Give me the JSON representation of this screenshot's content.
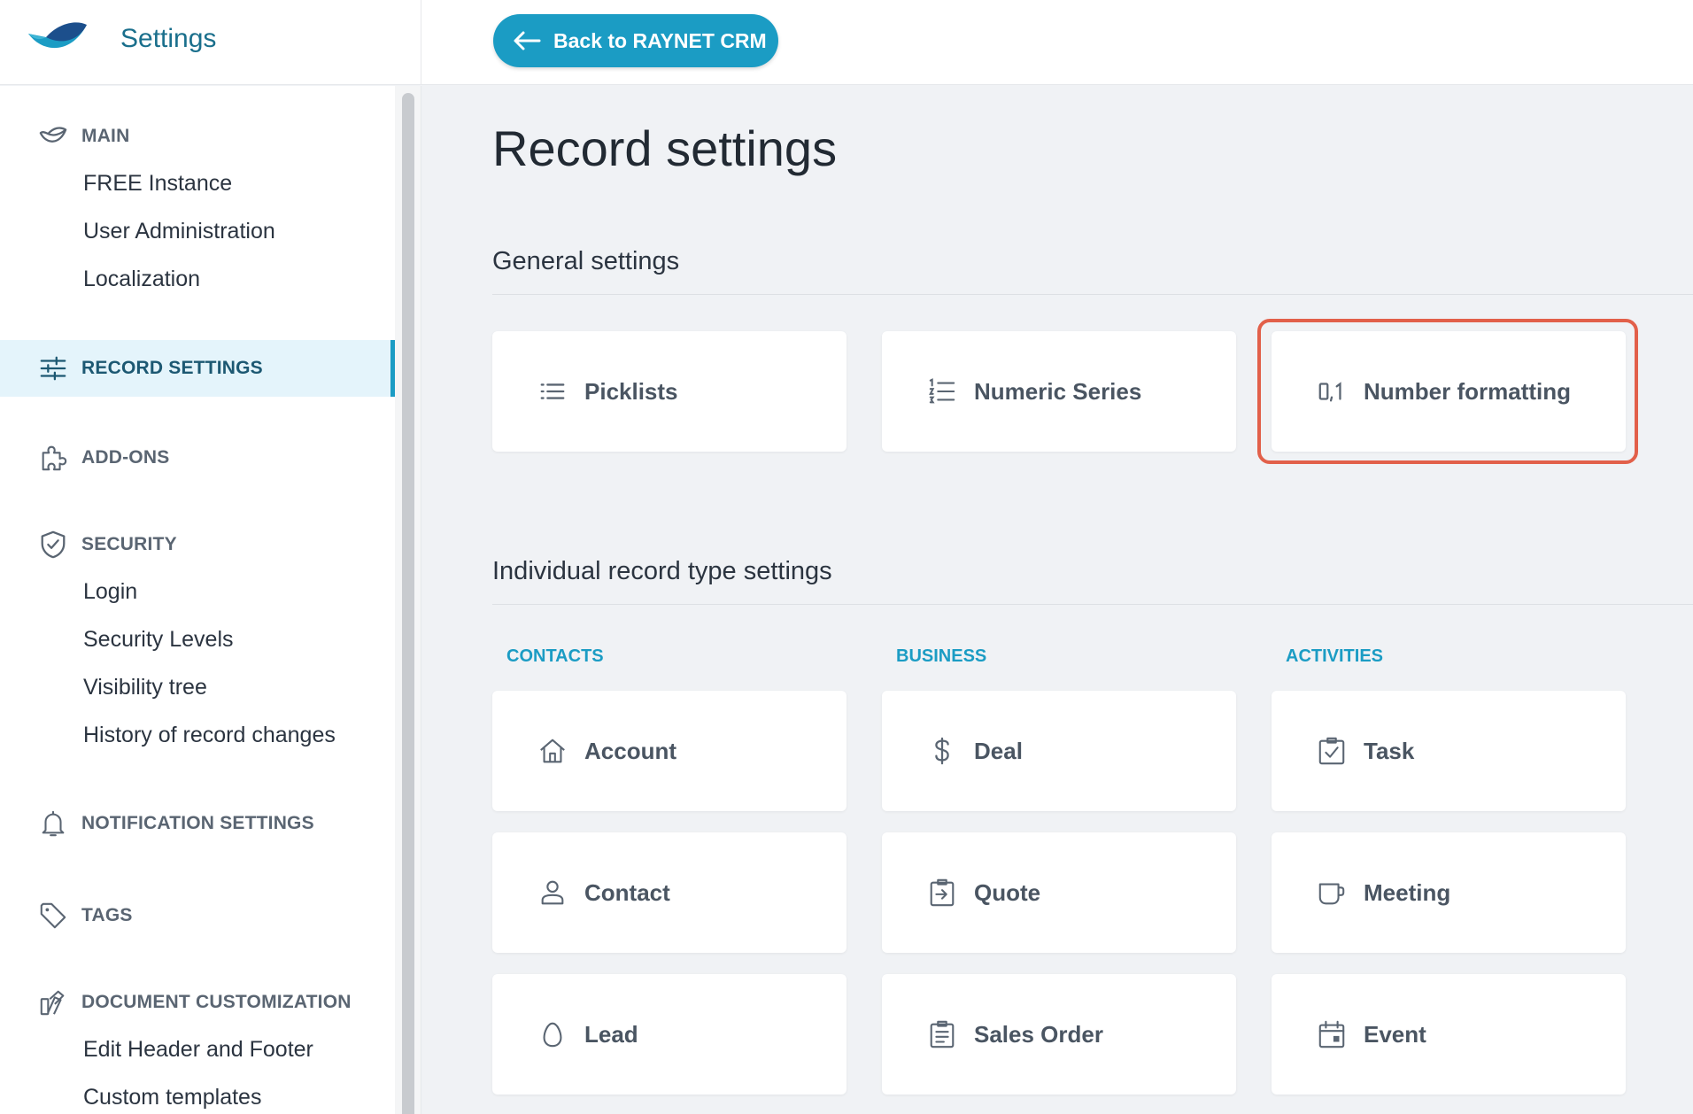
{
  "header": {
    "app_title": "Settings",
    "back_label": "Back to RAYNET CRM"
  },
  "sidebar": {
    "main": {
      "label": "MAIN",
      "items": [
        "FREE Instance",
        "User Administration",
        "Localization"
      ]
    },
    "record_settings": {
      "label": "RECORD SETTINGS"
    },
    "addons": {
      "label": "ADD-ONS"
    },
    "security": {
      "label": "SECURITY",
      "items": [
        "Login",
        "Security Levels",
        "Visibility tree",
        "History of record changes"
      ]
    },
    "notifications": {
      "label": "NOTIFICATION SETTINGS"
    },
    "tags": {
      "label": "TAGS"
    },
    "documents": {
      "label": "DOCUMENT CUSTOMIZATION",
      "items": [
        "Edit Header and Footer",
        "Custom templates"
      ]
    }
  },
  "page": {
    "title": "Record settings",
    "general": {
      "title": "General settings",
      "cards": [
        {
          "label": "Picklists",
          "icon": "list-icon"
        },
        {
          "label": "Numeric Series",
          "icon": "numbered-list-icon"
        },
        {
          "label": "Number formatting",
          "icon": "number-format-icon"
        }
      ]
    },
    "individual": {
      "title": "Individual record type settings",
      "categories": [
        {
          "label": "CONTACTS",
          "cards": [
            {
              "label": "Account",
              "icon": "home-icon"
            },
            {
              "label": "Contact",
              "icon": "person-icon"
            },
            {
              "label": "Lead",
              "icon": "egg-icon"
            }
          ]
        },
        {
          "label": "BUSINESS",
          "cards": [
            {
              "label": "Deal",
              "icon": "dollar-icon"
            },
            {
              "label": "Quote",
              "icon": "quote-doc-icon"
            },
            {
              "label": "Sales Order",
              "icon": "clipboard-icon"
            }
          ]
        },
        {
          "label": "ACTIVITIES",
          "cards": [
            {
              "label": "Task",
              "icon": "checkbox-icon"
            },
            {
              "label": "Meeting",
              "icon": "cup-icon"
            },
            {
              "label": "Event",
              "icon": "calendar-icon"
            }
          ]
        }
      ]
    }
  },
  "colors": {
    "accent": "#1b9cc4",
    "highlight": "#e2604a",
    "active_bg": "#e4f4fb"
  }
}
